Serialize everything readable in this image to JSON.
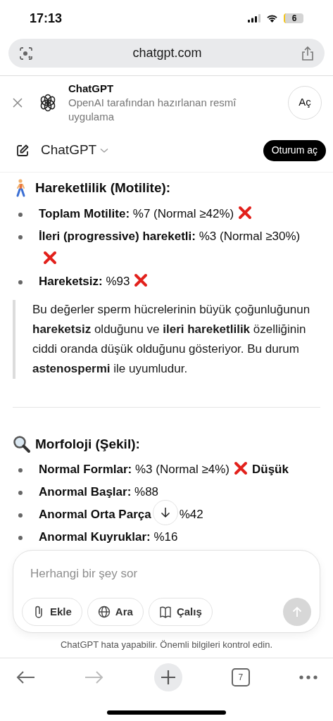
{
  "status_bar": {
    "time": "17:13",
    "battery": "6"
  },
  "address_bar": {
    "url": "chatgpt.com"
  },
  "app_banner": {
    "title": "ChatGPT",
    "subtitle": "OpenAI tarafından hazırlanan resmî uygulama",
    "button": "Aç"
  },
  "header": {
    "title": "ChatGPT",
    "login": "Oturum aç"
  },
  "sections": [
    {
      "title": "Hareketlilik (Motilite):",
      "items": [
        {
          "text": "**Toplam Motilite:** %7 (Normal ≥42%)",
          "cross": true
        },
        {
          "text": "**İleri (progressive) hareketli:** %3 (Normal ≥30%)",
          "cross": true
        },
        {
          "text": "**Hareketsiz:** %93",
          "cross": true
        }
      ],
      "quote": "Bu değerler sperm hücrelerinin büyük çoğunluğunun **hareketsiz** olduğunu ve **ileri hareketlilik** özelliğinin ciddi oranda düşük olduğunu gösteriyor. Bu durum **astenospermi** ile uyumludur."
    },
    {
      "title": "Morfoloji (Şekil):",
      "items": [
        {
          "text": "**Normal Formlar:** %3 (Normal ≥4%)",
          "cross": true,
          "after": "Düşük"
        },
        {
          "text": "**Anormal Başlar:** %88",
          "cross": false
        },
        {
          "text": "**Anormal Orta Parça**",
          "rest": "%42",
          "cross": false
        },
        {
          "text": "**Anormal Kuyruklar:** %16",
          "cross": false
        }
      ]
    }
  ],
  "composer": {
    "placeholder": "Herhangi bir şey sor",
    "buttons": [
      {
        "label": "Ekle"
      },
      {
        "label": "Ara"
      },
      {
        "label": "Çalış"
      }
    ],
    "send_disabled": true
  },
  "disclaimer": "ChatGPT hata yapabilir. Önemli bilgileri kontrol edin.",
  "toolbar": {
    "tabs": "7"
  }
}
